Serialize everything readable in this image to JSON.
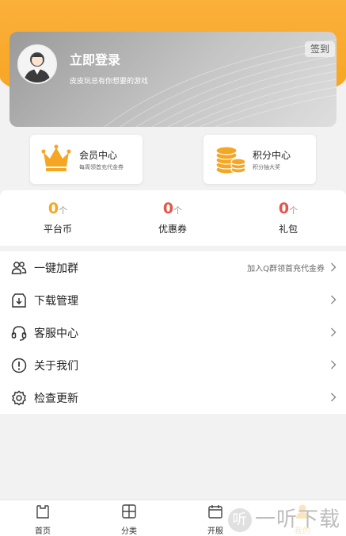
{
  "colors": {
    "accent": "#f5a623",
    "red": "#e4554a",
    "gray": "#999999"
  },
  "profile": {
    "title": "立即登录",
    "subtitle": "皮皮玩总有你想要的游戏",
    "signin": "签到",
    "avatar_icon": "user-avatar-icon"
  },
  "quick_links": [
    {
      "title": "会员中心",
      "subtitle": "每周领首充代金券",
      "icon": "crown-icon"
    },
    {
      "title": "积分中心",
      "subtitle": "积分抽大奖",
      "icon": "coins-icon"
    }
  ],
  "stats": [
    {
      "value": "0",
      "unit": "个",
      "label": "平台币"
    },
    {
      "value": "0",
      "unit": "个",
      "label": "优惠券"
    },
    {
      "value": "0",
      "unit": "个",
      "label": "礼包"
    }
  ],
  "menu": [
    {
      "label": "一键加群",
      "extra": "加入Q群领首充代金券",
      "icon": "group-icon"
    },
    {
      "label": "下载管理",
      "extra": "",
      "icon": "download-icon"
    },
    {
      "label": "客服中心",
      "extra": "",
      "icon": "headset-icon"
    },
    {
      "label": "关于我们",
      "extra": "",
      "icon": "info-icon"
    },
    {
      "label": "检查更新",
      "extra": "",
      "icon": "settings-icon"
    }
  ],
  "tabs": [
    {
      "label": "首页",
      "icon": "home-icon"
    },
    {
      "label": "分类",
      "icon": "grid-icon"
    },
    {
      "label": "开服",
      "icon": "calendar-icon"
    },
    {
      "label": "我的",
      "icon": "user-icon",
      "active": true
    }
  ],
  "watermark": "一听下载"
}
